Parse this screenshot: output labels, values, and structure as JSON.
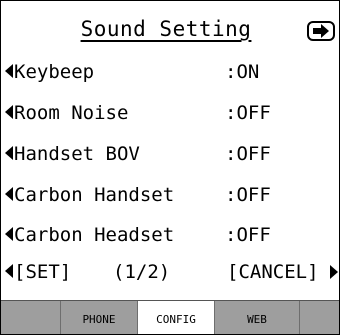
{
  "header": {
    "title": "Sound Setting",
    "exit_icon": "exit-arrow-icon"
  },
  "settings": [
    {
      "label": "Keybeep",
      "value": ":ON"
    },
    {
      "label": "Room Noise",
      "value": ":OFF"
    },
    {
      "label": "Handset BOV",
      "value": ":OFF"
    },
    {
      "label": "Carbon Handset",
      "value": ":OFF"
    },
    {
      "label": "Carbon Headset",
      "value": ":OFF"
    }
  ],
  "footer_row": {
    "set_label": "[SET]",
    "page": "(1/2)",
    "cancel_label": "[CANCEL]"
  },
  "tabs": [
    {
      "label": ""
    },
    {
      "label": "PHONE"
    },
    {
      "label": "CONFIG",
      "active": true
    },
    {
      "label": "WEB"
    },
    {
      "label": ""
    }
  ]
}
